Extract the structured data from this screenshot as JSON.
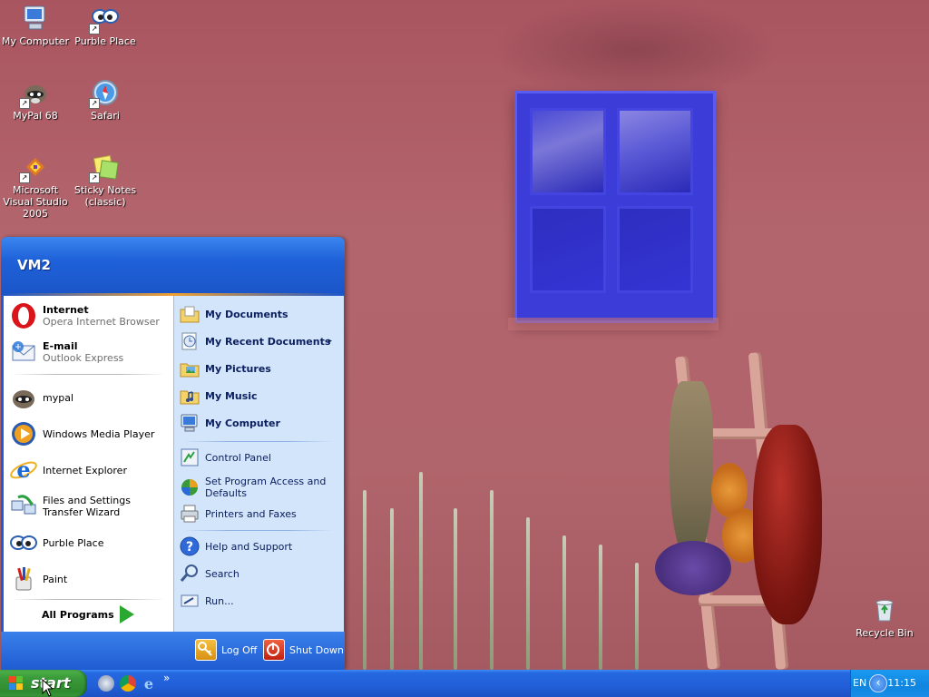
{
  "desktop": {
    "icons": [
      {
        "label": "My Computer"
      },
      {
        "label": "Purble Place"
      },
      {
        "label": "MyPal 68"
      },
      {
        "label": "Safari"
      },
      {
        "label": "Microsoft Visual Studio 2005"
      },
      {
        "label": "Sticky Notes (classic)"
      },
      {
        "label": "Recycle Bin"
      }
    ]
  },
  "start_menu": {
    "user": "VM2",
    "pinned": [
      {
        "title": "Internet",
        "subtitle": "Opera Internet Browser"
      },
      {
        "title": "E-mail",
        "subtitle": "Outlook Express"
      }
    ],
    "recent": [
      {
        "label": "mypal"
      },
      {
        "label": "Windows Media Player"
      },
      {
        "label": "Internet Explorer"
      },
      {
        "label": "Files and Settings Transfer Wizard"
      },
      {
        "label": "Purble Place"
      },
      {
        "label": "Paint"
      }
    ],
    "all_programs": "All Programs",
    "places": [
      {
        "label": "My Documents"
      },
      {
        "label": "My Recent Documents"
      },
      {
        "label": "My Pictures"
      },
      {
        "label": "My Music"
      },
      {
        "label": "My Computer"
      }
    ],
    "settings": [
      {
        "label": "Control Panel"
      },
      {
        "label": "Set Program Access and Defaults"
      },
      {
        "label": "Printers and Faxes"
      }
    ],
    "help": [
      {
        "label": "Help and Support"
      },
      {
        "label": "Search"
      },
      {
        "label": "Run..."
      }
    ],
    "submenu_arrow": "▸",
    "log_off": "Log Off",
    "shut_down": "Shut Down"
  },
  "taskbar": {
    "start_label": "start",
    "quick_launch_more": "»",
    "language": "EN",
    "tray_expand": "‹",
    "clock": "11:15"
  }
}
